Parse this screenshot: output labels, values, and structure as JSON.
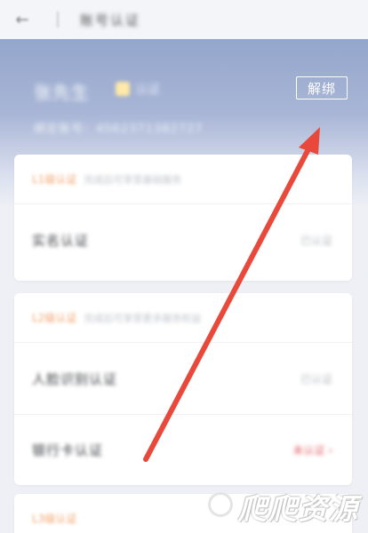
{
  "topbar": {
    "title": "账号认证"
  },
  "hero": {
    "name": "张先生",
    "badge_text": "认证",
    "subtitle": "绑定账号：4562371382727",
    "unbind_label": "解绑"
  },
  "cards": [
    {
      "level": "L1级认证",
      "level_desc": "完成后可享受基础服务",
      "rows": [
        {
          "label": "实名认证",
          "status": "已认证",
          "warn": false
        }
      ]
    },
    {
      "level": "L2级认证",
      "level_desc": "完成后可享受更多服务权益",
      "rows": [
        {
          "label": "人脸识别认证",
          "status": "已认证",
          "warn": false
        },
        {
          "label": "银行卡认证",
          "status": "未认证 ›",
          "warn": true
        }
      ]
    },
    {
      "level": "L3级认证",
      "level_desc": "",
      "rows": []
    }
  ],
  "watermark": {
    "text": "爬爬资源"
  },
  "colors": {
    "accent_arrow": "#e8493b",
    "hero_top": "#94a6cc",
    "level_orange": "#f0a26a"
  }
}
